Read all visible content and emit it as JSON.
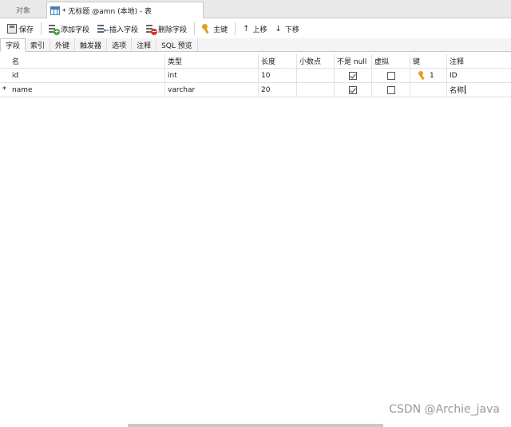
{
  "window_tabs": {
    "objects": "对象",
    "table_tab": "* 无标题 @amn (本地) - 表"
  },
  "toolbar": {
    "save": "保存",
    "add_field": "添加字段",
    "insert_field": "插入字段",
    "delete_field": "删除字段",
    "primary_key": "主键",
    "move_up": "上移",
    "move_down": "下移"
  },
  "sub_tabs": [
    "字段",
    "索引",
    "外键",
    "触发器",
    "选项",
    "注释",
    "SQL 预览"
  ],
  "columns": {
    "name": "名",
    "type": "类型",
    "length": "长度",
    "decimal": "小数点",
    "not_null": "不是 null",
    "virtual": "虚拟",
    "key": "键",
    "comment": "注释"
  },
  "rows": [
    {
      "marker": "",
      "name": "id",
      "type": "int",
      "length": "10",
      "decimal": "",
      "not_null": true,
      "virtual": false,
      "key": "1",
      "comment": "ID"
    },
    {
      "marker": "*",
      "name": "name",
      "type": "varchar",
      "length": "20",
      "decimal": "",
      "not_null": true,
      "virtual": false,
      "key": "",
      "comment": "名称"
    }
  ],
  "watermark": "CSDN @Archie_java"
}
